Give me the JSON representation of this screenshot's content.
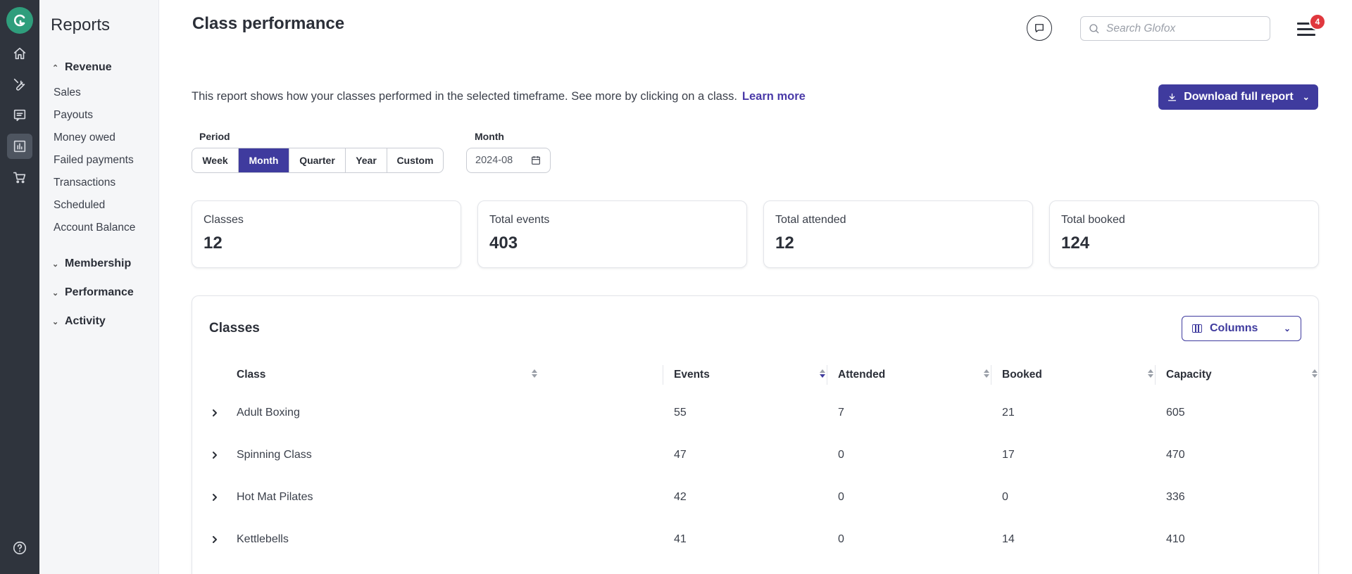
{
  "nav": {
    "title": "Reports",
    "sections": [
      {
        "label": "Revenue",
        "expanded": true,
        "items": [
          "Sales",
          "Payouts",
          "Money owed",
          "Failed payments",
          "Transactions",
          "Scheduled",
          "Account Balance"
        ]
      },
      {
        "label": "Membership",
        "expanded": false
      },
      {
        "label": "Performance",
        "expanded": false
      },
      {
        "label": "Activity",
        "expanded": false
      }
    ]
  },
  "header": {
    "title": "Class performance",
    "search_placeholder": "Search Glofox",
    "notification_count": "4"
  },
  "intro": {
    "text": "This report shows how your classes performed in the selected timeframe. See more by clicking on a class.",
    "link": "Learn more"
  },
  "download_label": "Download full report",
  "filters": {
    "period_label": "Period",
    "period_options": [
      "Week",
      "Month",
      "Quarter",
      "Year",
      "Custom"
    ],
    "period_selected": "Month",
    "month_label": "Month",
    "month_value": "2024-08"
  },
  "stats": [
    {
      "label": "Classes",
      "value": "12"
    },
    {
      "label": "Total events",
      "value": "403"
    },
    {
      "label": "Total attended",
      "value": "12"
    },
    {
      "label": "Total booked",
      "value": "124"
    }
  ],
  "table": {
    "title": "Classes",
    "columns_button": "Columns",
    "headers": [
      "Class",
      "Events",
      "Attended",
      "Booked",
      "Capacity"
    ],
    "rows": [
      [
        "Adult Boxing",
        "55",
        "7",
        "21",
        "605"
      ],
      [
        "Spinning Class",
        "47",
        "0",
        "17",
        "470"
      ],
      [
        "Hot Mat Pilates",
        "42",
        "0",
        "0",
        "336"
      ],
      [
        "Kettlebells",
        "41",
        "0",
        "14",
        "410"
      ]
    ]
  },
  "colors": {
    "rail": "#2f343d",
    "brand_green": "#2f9e7c",
    "accent": "#3f3b9e",
    "badge": "#e0383e"
  }
}
